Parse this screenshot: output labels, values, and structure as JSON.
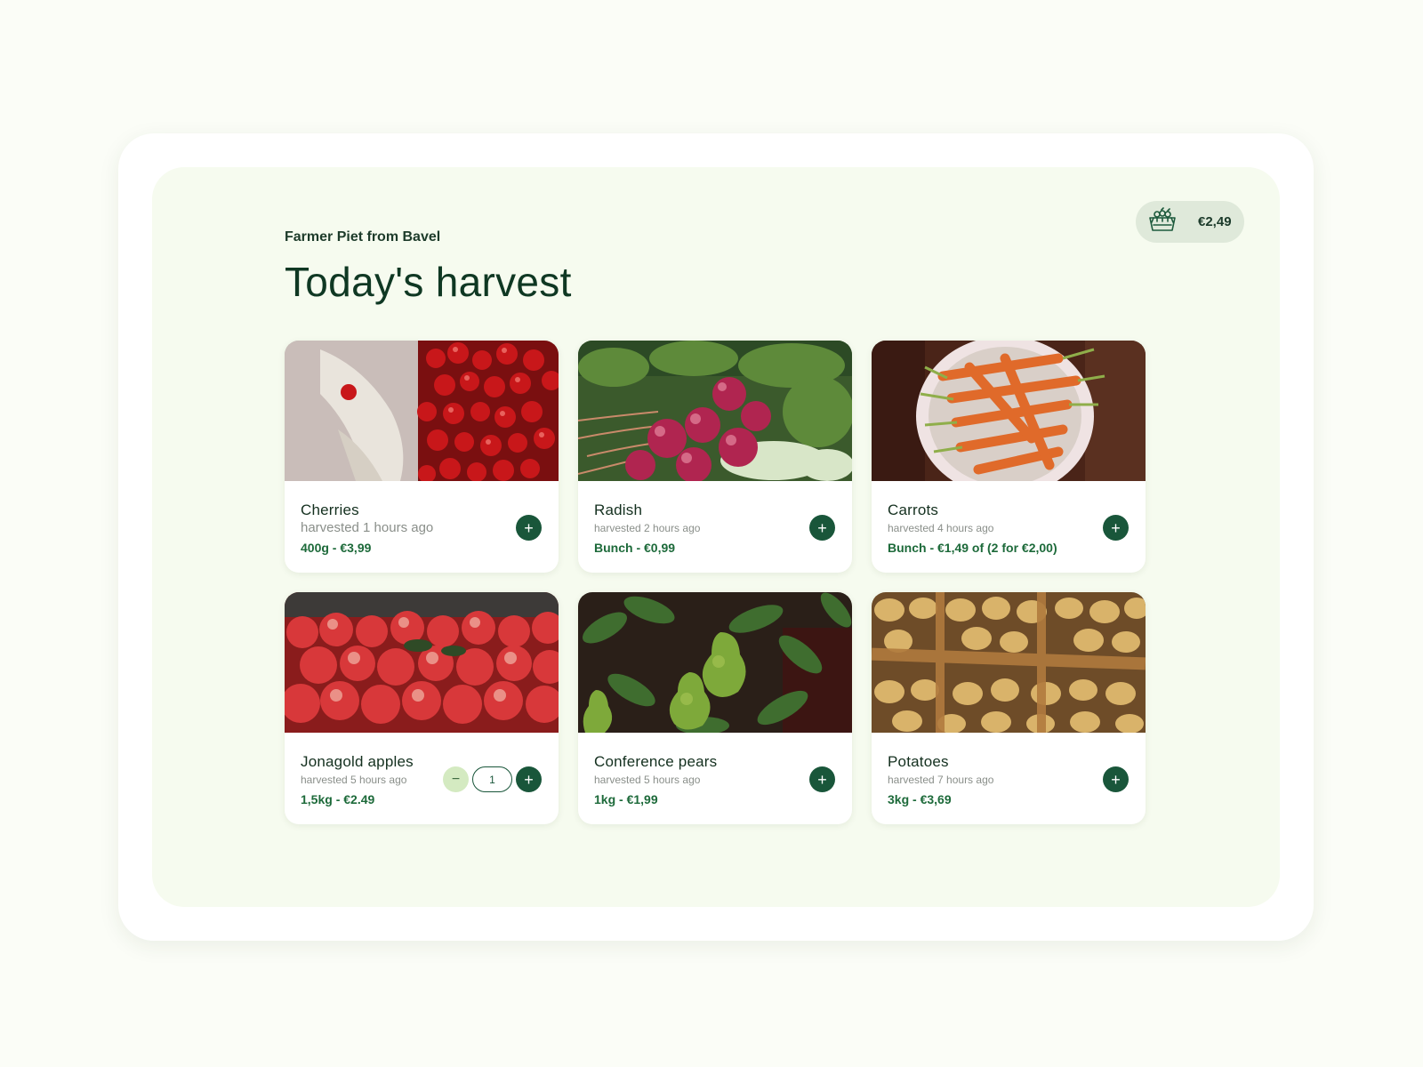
{
  "header": {
    "subtitle": "Farmer Piet from Bavel",
    "title": "Today's harvest"
  },
  "cart": {
    "icon": "basket-icon",
    "total": "€2,49"
  },
  "products": [
    {
      "name": "Cherries",
      "harvested": "harvested 1 hours ago",
      "price": "400g - €3,99",
      "add_label": "+"
    },
    {
      "name": "Radish",
      "harvested": "harvested 2 hours ago",
      "price": "Bunch - €0,99",
      "add_label": "+"
    },
    {
      "name": "Carrots",
      "harvested": "harvested 4 hours ago",
      "price": "Bunch - €1,49 of (2 for €2,00)",
      "add_label": "+"
    },
    {
      "name": "Jonagold apples",
      "harvested": "harvested 5 hours ago",
      "price": "1,5kg - €2.49",
      "add_label": "+",
      "minus_label": "−",
      "quantity": "1"
    },
    {
      "name": "Conference pears",
      "harvested": "harvested 5 hours ago",
      "price": "1kg - €1,99",
      "add_label": "+"
    },
    {
      "name": "Potatoes",
      "harvested": "harvested 7 hours ago",
      "price": "3kg - €3,69",
      "add_label": "+"
    }
  ],
  "colors": {
    "accent": "#19563a",
    "price": "#1d6a3a",
    "panel": "#f6fbef"
  }
}
